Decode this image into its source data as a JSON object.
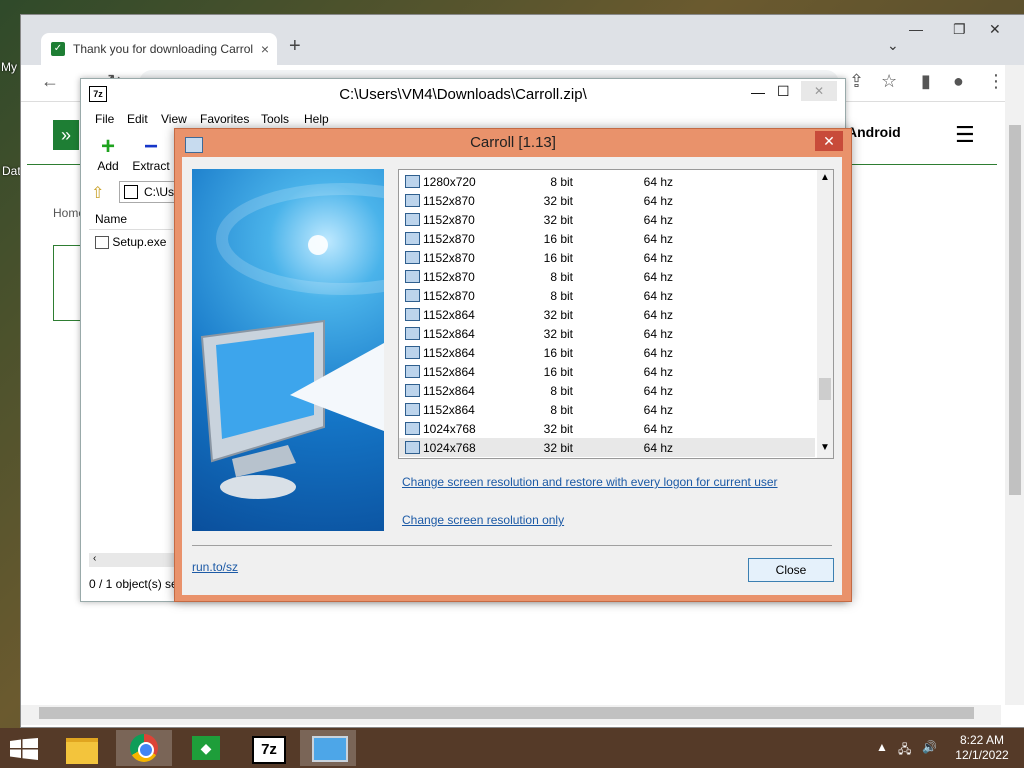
{
  "desktop": {
    "icons": [
      {
        "label": "My"
      },
      {
        "label": "Dat"
      }
    ]
  },
  "chrome": {
    "tab_title": "Thank you for downloading Carroll",
    "tab_close": "×",
    "new_tab": "+",
    "page": {
      "home": "Home",
      "android": "Android",
      "menu_glyph": "☰"
    }
  },
  "sevenzip": {
    "title": "C:\\Users\\VM4\\Downloads\\Carroll.zip\\",
    "app_icon": "7z",
    "menu": [
      "File",
      "Edit",
      "View",
      "Favorites",
      "Tools",
      "Help"
    ],
    "toolbar": {
      "add": "Add",
      "extract": "Extract"
    },
    "path": "C:\\Us",
    "column_name": "Name",
    "file": "Setup.exe",
    "status": "0 / 1 object(s) se"
  },
  "carroll": {
    "title": "Carroll [1.13]",
    "resolutions": [
      {
        "res": "1280x720",
        "bit": "8 bit",
        "hz": "64 hz"
      },
      {
        "res": "1152x870",
        "bit": "32 bit",
        "hz": "64 hz"
      },
      {
        "res": "1152x870",
        "bit": "32 bit",
        "hz": "64 hz"
      },
      {
        "res": "1152x870",
        "bit": "16 bit",
        "hz": "64 hz"
      },
      {
        "res": "1152x870",
        "bit": "16 bit",
        "hz": "64 hz"
      },
      {
        "res": "1152x870",
        "bit": "8 bit",
        "hz": "64 hz"
      },
      {
        "res": "1152x870",
        "bit": "8 bit",
        "hz": "64 hz"
      },
      {
        "res": "1152x864",
        "bit": "32 bit",
        "hz": "64 hz"
      },
      {
        "res": "1152x864",
        "bit": "32 bit",
        "hz": "64 hz"
      },
      {
        "res": "1152x864",
        "bit": "16 bit",
        "hz": "64 hz"
      },
      {
        "res": "1152x864",
        "bit": "16 bit",
        "hz": "64 hz"
      },
      {
        "res": "1152x864",
        "bit": "8 bit",
        "hz": "64 hz"
      },
      {
        "res": "1152x864",
        "bit": "8 bit",
        "hz": "64 hz"
      },
      {
        "res": "1024x768",
        "bit": "32 bit",
        "hz": "64 hz"
      },
      {
        "res": "1024x768",
        "bit": "32 bit",
        "hz": "64 hz"
      }
    ],
    "link_restore": "Change screen resolution and restore with every logon for current user",
    "link_only": "Change screen resolution only",
    "footer_link": "run.to/sz",
    "close_button": "Close"
  },
  "taskbar": {
    "time": "8:22 AM",
    "date": "12/1/2022",
    "items": [
      "file-explorer",
      "chrome",
      "game",
      "7-zip",
      "carroll"
    ]
  }
}
